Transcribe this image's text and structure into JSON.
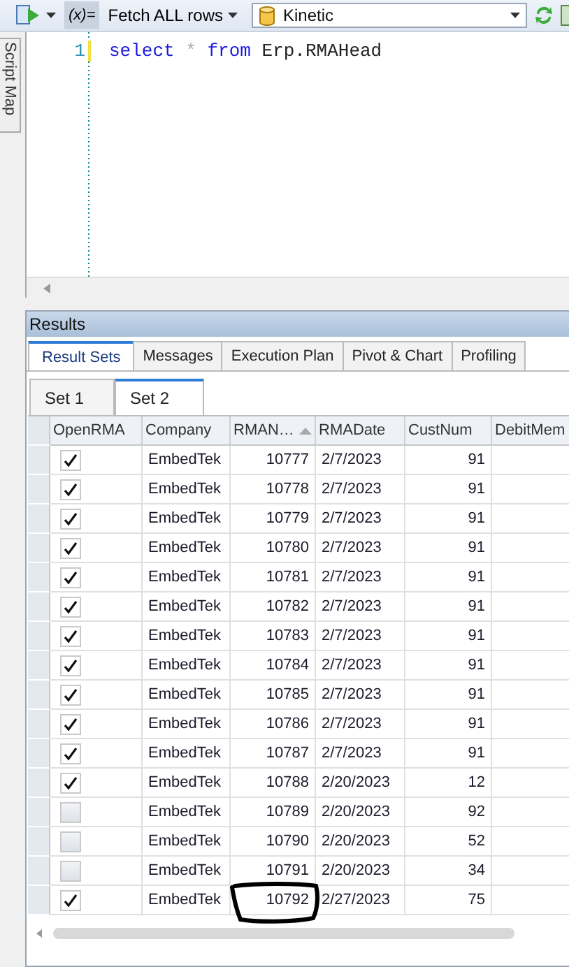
{
  "toolbar": {
    "fetch_mode": "Fetch ALL rows",
    "variables_label": "(x)=",
    "database": "Kinetic"
  },
  "side_tab": {
    "label": "Script Map"
  },
  "editor": {
    "lines": [
      {
        "number": "1",
        "tokens": [
          {
            "kind": "keyword",
            "text": "select"
          },
          {
            "kind": "operator",
            "text": "*"
          },
          {
            "kind": "keyword",
            "text": "from"
          },
          {
            "kind": "name",
            "text": "Erp.RMAHead"
          }
        ]
      }
    ]
  },
  "results": {
    "title": "Results",
    "tabs": [
      {
        "label": "Result Sets",
        "selected": true
      },
      {
        "label": "Messages",
        "selected": false
      },
      {
        "label": "Execution Plan",
        "selected": false
      },
      {
        "label": "Pivot & Chart",
        "selected": false
      },
      {
        "label": "Profiling",
        "selected": false
      }
    ],
    "sets": [
      {
        "label": "Set 1",
        "selected": false
      },
      {
        "label": "Set 2",
        "selected": true
      }
    ],
    "table": {
      "columns": [
        {
          "label": "OpenRMA",
          "kind": "check"
        },
        {
          "label": "Company",
          "kind": "text"
        },
        {
          "label": "RMAN…",
          "kind": "number",
          "sorted": true
        },
        {
          "label": "RMADate",
          "kind": "text"
        },
        {
          "label": "CustNum",
          "kind": "number"
        },
        {
          "label": "DebitMem",
          "kind": "text"
        }
      ],
      "rows": [
        {
          "open": true,
          "company": "EmbedTek",
          "rma": "10777",
          "date": "2/7/2023",
          "cust": "91"
        },
        {
          "open": true,
          "company": "EmbedTek",
          "rma": "10778",
          "date": "2/7/2023",
          "cust": "91"
        },
        {
          "open": true,
          "company": "EmbedTek",
          "rma": "10779",
          "date": "2/7/2023",
          "cust": "91"
        },
        {
          "open": true,
          "company": "EmbedTek",
          "rma": "10780",
          "date": "2/7/2023",
          "cust": "91"
        },
        {
          "open": true,
          "company": "EmbedTek",
          "rma": "10781",
          "date": "2/7/2023",
          "cust": "91"
        },
        {
          "open": true,
          "company": "EmbedTek",
          "rma": "10782",
          "date": "2/7/2023",
          "cust": "91"
        },
        {
          "open": true,
          "company": "EmbedTek",
          "rma": "10783",
          "date": "2/7/2023",
          "cust": "91"
        },
        {
          "open": true,
          "company": "EmbedTek",
          "rma": "10784",
          "date": "2/7/2023",
          "cust": "91"
        },
        {
          "open": true,
          "company": "EmbedTek",
          "rma": "10785",
          "date": "2/7/2023",
          "cust": "91"
        },
        {
          "open": true,
          "company": "EmbedTek",
          "rma": "10786",
          "date": "2/7/2023",
          "cust": "91"
        },
        {
          "open": true,
          "company": "EmbedTek",
          "rma": "10787",
          "date": "2/7/2023",
          "cust": "91"
        },
        {
          "open": true,
          "company": "EmbedTek",
          "rma": "10788",
          "date": "2/20/2023",
          "cust": "12"
        },
        {
          "open": false,
          "company": "EmbedTek",
          "rma": "10789",
          "date": "2/20/2023",
          "cust": "92"
        },
        {
          "open": false,
          "company": "EmbedTek",
          "rma": "10790",
          "date": "2/20/2023",
          "cust": "52"
        },
        {
          "open": false,
          "company": "EmbedTek",
          "rma": "10791",
          "date": "2/20/2023",
          "cust": "34"
        },
        {
          "open": true,
          "company": "EmbedTek",
          "rma": "10792",
          "date": "2/27/2023",
          "cust": "75"
        }
      ]
    }
  }
}
